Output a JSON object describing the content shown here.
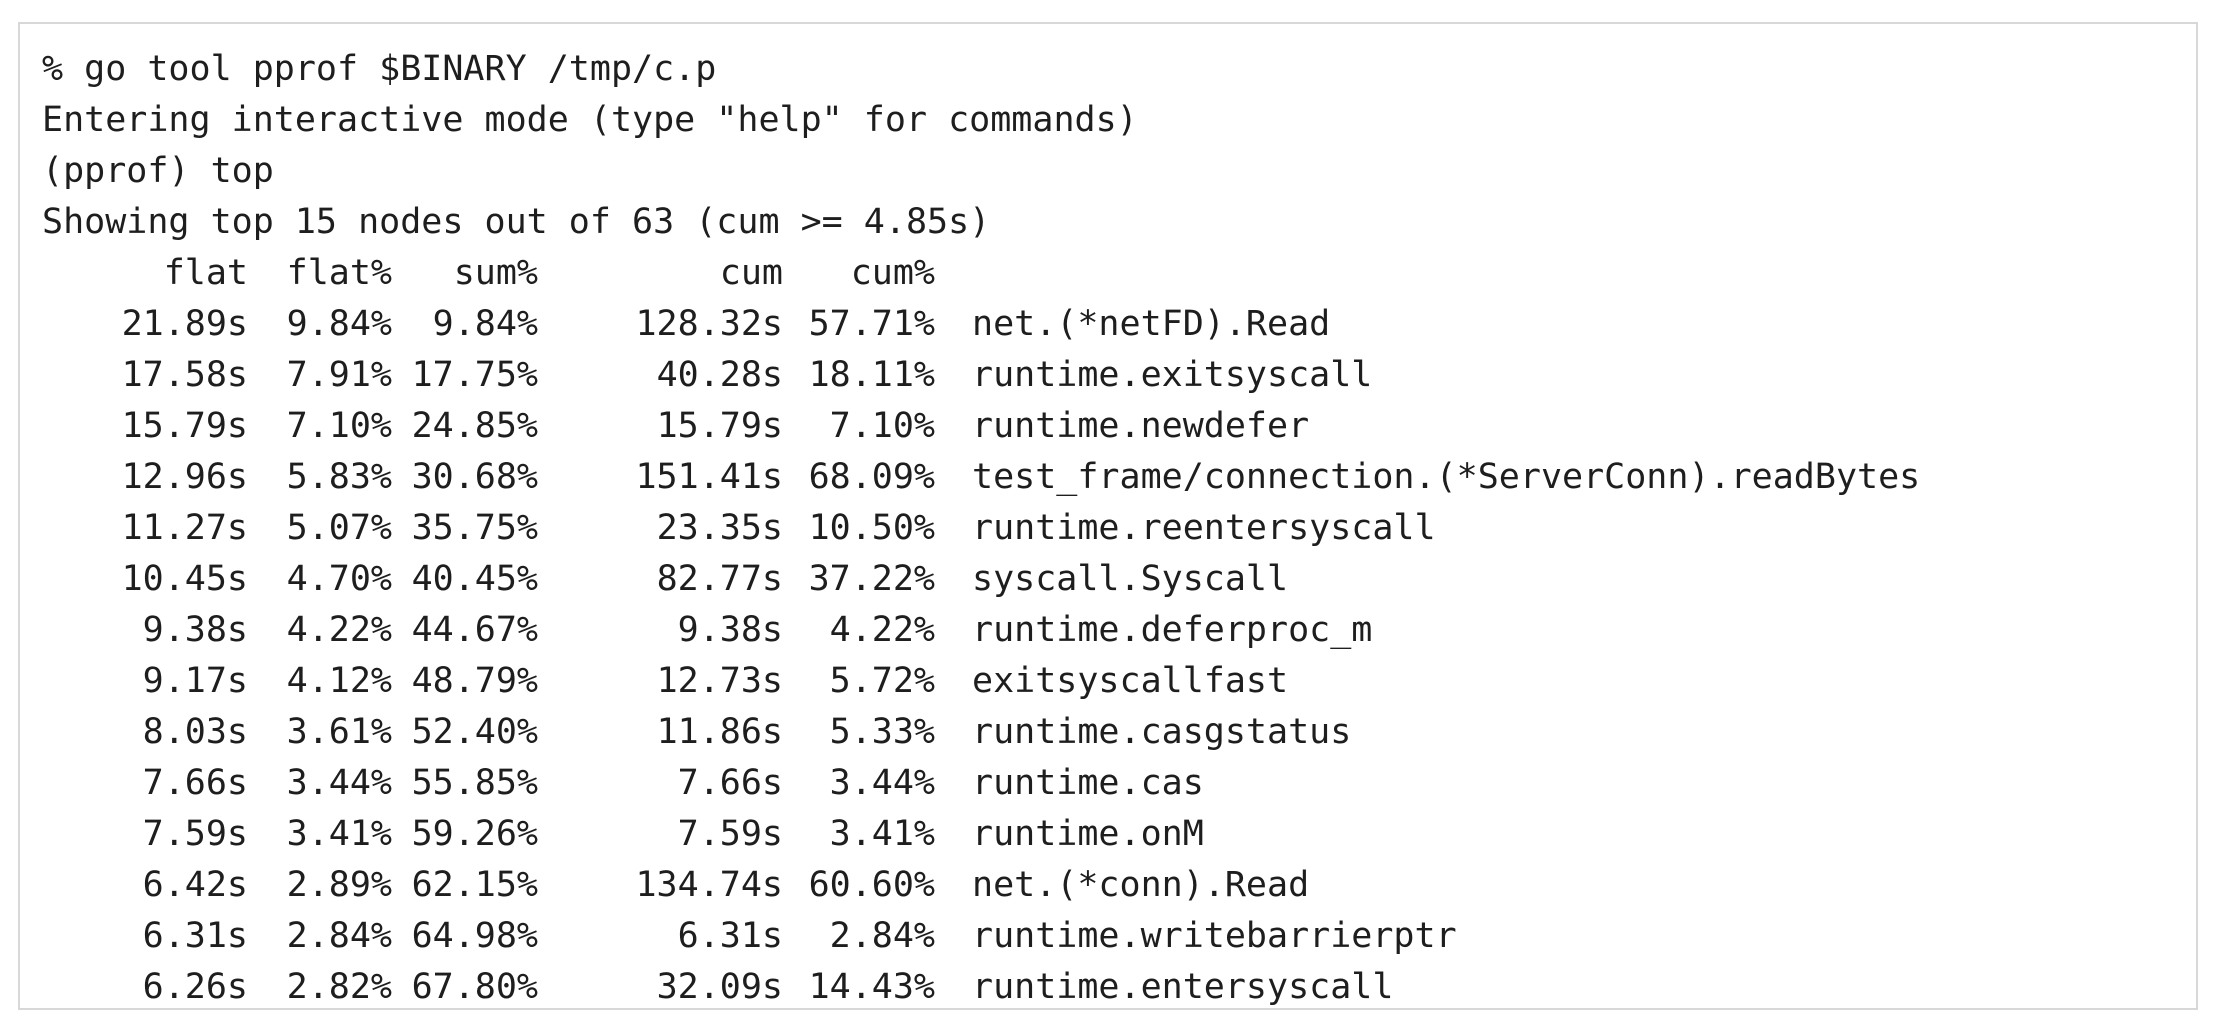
{
  "session": {
    "command": "% go tool pprof $BINARY /tmp/c.p",
    "mode_msg": "Entering interactive mode (type \"help\" for commands)",
    "prompt_cmd": "(pprof) top",
    "summary": "Showing top 15 nodes out of 63 (cum >= 4.85s)"
  },
  "table": {
    "headers": {
      "flat": "flat",
      "flat_pct": "flat%",
      "sum_pct": "sum%",
      "cum": "cum",
      "cum_pct": "cum%"
    },
    "rows": [
      {
        "flat": "21.89s",
        "flat_pct": "9.84%",
        "sum_pct": "9.84%",
        "cum": "128.32s",
        "cum_pct": "57.71%",
        "name": "net.(*netFD).Read"
      },
      {
        "flat": "17.58s",
        "flat_pct": "7.91%",
        "sum_pct": "17.75%",
        "cum": "40.28s",
        "cum_pct": "18.11%",
        "name": "runtime.exitsyscall"
      },
      {
        "flat": "15.79s",
        "flat_pct": "7.10%",
        "sum_pct": "24.85%",
        "cum": "15.79s",
        "cum_pct": "7.10%",
        "name": "runtime.newdefer"
      },
      {
        "flat": "12.96s",
        "flat_pct": "5.83%",
        "sum_pct": "30.68%",
        "cum": "151.41s",
        "cum_pct": "68.09%",
        "name": "test_frame/connection.(*ServerConn).readBytes"
      },
      {
        "flat": "11.27s",
        "flat_pct": "5.07%",
        "sum_pct": "35.75%",
        "cum": "23.35s",
        "cum_pct": "10.50%",
        "name": "runtime.reentersyscall"
      },
      {
        "flat": "10.45s",
        "flat_pct": "4.70%",
        "sum_pct": "40.45%",
        "cum": "82.77s",
        "cum_pct": "37.22%",
        "name": "syscall.Syscall"
      },
      {
        "flat": "9.38s",
        "flat_pct": "4.22%",
        "sum_pct": "44.67%",
        "cum": "9.38s",
        "cum_pct": "4.22%",
        "name": "runtime.deferproc_m"
      },
      {
        "flat": "9.17s",
        "flat_pct": "4.12%",
        "sum_pct": "48.79%",
        "cum": "12.73s",
        "cum_pct": "5.72%",
        "name": "exitsyscallfast"
      },
      {
        "flat": "8.03s",
        "flat_pct": "3.61%",
        "sum_pct": "52.40%",
        "cum": "11.86s",
        "cum_pct": "5.33%",
        "name": "runtime.casgstatus"
      },
      {
        "flat": "7.66s",
        "flat_pct": "3.44%",
        "sum_pct": "55.85%",
        "cum": "7.66s",
        "cum_pct": "3.44%",
        "name": "runtime.cas"
      },
      {
        "flat": "7.59s",
        "flat_pct": "3.41%",
        "sum_pct": "59.26%",
        "cum": "7.59s",
        "cum_pct": "3.41%",
        "name": "runtime.onM"
      },
      {
        "flat": "6.42s",
        "flat_pct": "2.89%",
        "sum_pct": "62.15%",
        "cum": "134.74s",
        "cum_pct": "60.60%",
        "name": "net.(*conn).Read"
      },
      {
        "flat": "6.31s",
        "flat_pct": "2.84%",
        "sum_pct": "64.98%",
        "cum": "6.31s",
        "cum_pct": "2.84%",
        "name": "runtime.writebarrierptr"
      },
      {
        "flat": "6.26s",
        "flat_pct": "2.82%",
        "sum_pct": "67.80%",
        "cum": "32.09s",
        "cum_pct": "14.43%",
        "name": "runtime.entersyscall"
      }
    ]
  }
}
